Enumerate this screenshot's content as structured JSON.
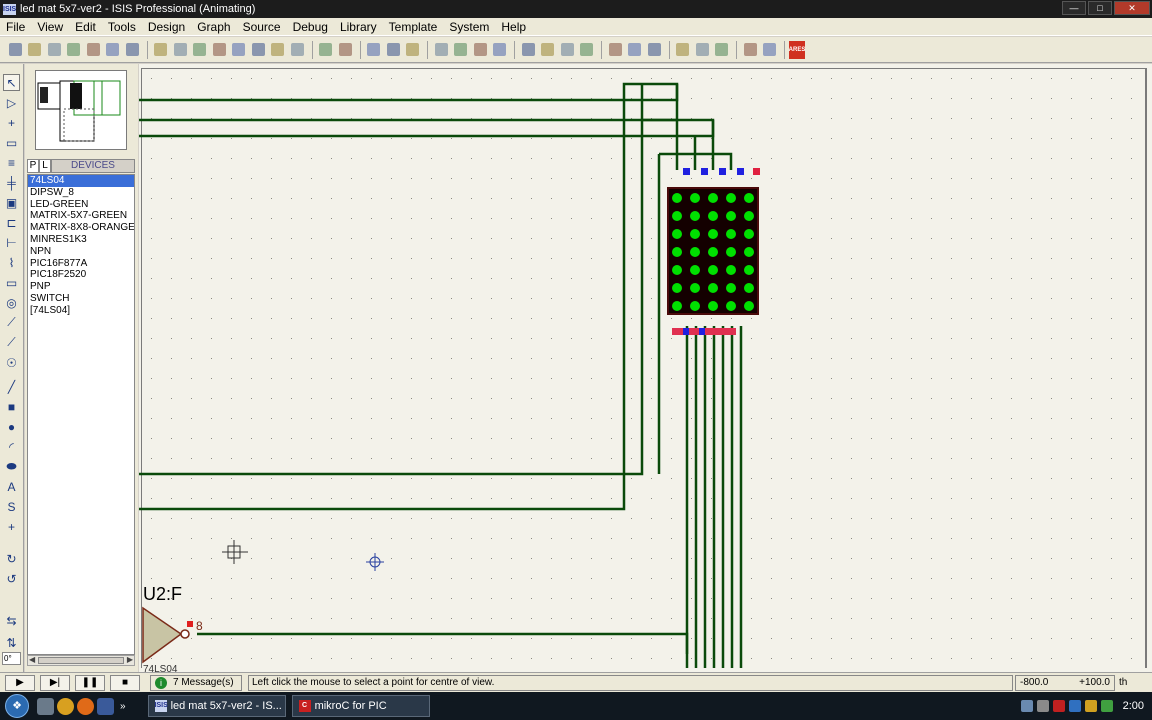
{
  "window": {
    "title": "led mat 5x7-ver2 - ISIS Professional (Animating)",
    "app_icon": "ISIS",
    "controls": [
      "minimize",
      "maximize",
      "close"
    ]
  },
  "menu": [
    "File",
    "View",
    "Edit",
    "Tools",
    "Design",
    "Graph",
    "Source",
    "Debug",
    "Library",
    "Template",
    "System",
    "Help"
  ],
  "toolbar": {
    "icons": [
      "new-icon",
      "open-icon",
      "save-icon",
      "import-icon",
      "export-icon",
      "print-icon",
      "print-area-icon",
      "|",
      "redraw-icon",
      "grid-icon",
      "origin-icon",
      "pan-icon",
      "zoom-in-icon",
      "zoom-out-icon",
      "zoom-all-icon",
      "zoom-area-icon",
      "|",
      "undo-icon",
      "redo-icon",
      "|",
      "cut-icon",
      "copy-icon",
      "paste-icon",
      "|",
      "block-copy-icon",
      "block-move-icon",
      "block-rotate-icon",
      "block-delete-icon",
      "|",
      "pick-device-icon",
      "make-device-icon",
      "packaging-icon",
      "decompose-icon",
      "|",
      "wire-autorouter-icon",
      "search-tag-icon",
      "property-assign-icon",
      "|",
      "new-sheet-icon",
      "remove-sheet-icon",
      "goto-sheet-icon",
      "|",
      "bom-icon",
      "erc-icon",
      "|",
      "ares-icon"
    ],
    "ares_label": "ARES"
  },
  "mode_tools": [
    "selection-mode-icon",
    "component-mode-icon",
    "junction-icon",
    "wire-label-icon",
    "text-script-icon",
    "bus-icon",
    "subcircuit-icon",
    "terminal-icon",
    "device-pin-icon",
    "graph-icon",
    "tape-recorder-icon",
    "generator-icon",
    "voltage-probe-icon",
    "current-probe-icon",
    "virtual-instruments-icon",
    "line-icon",
    "box-icon",
    "circle-icon",
    "arc-icon",
    "path-icon",
    "text-icon",
    "symbol-icon",
    "marker-icon",
    "rotate-cw-icon",
    "rotate-ccw-icon",
    "rotation-angle",
    "flip-horizontal-icon",
    "flip-vertical-icon"
  ],
  "rotation_value": "0°",
  "selector": {
    "tab_p": "P",
    "tab_l": "L",
    "label": "DEVICES",
    "devices": [
      "74LS04",
      "DIPSW_8",
      "LED-GREEN",
      "MATRIX-5X7-GREEN",
      "MATRIX-8X8-ORANGE",
      "MINRES1K3",
      "NPN",
      "PIC16F877A",
      "PIC18F2520",
      "PNP",
      "SWITCH",
      "[74LS04]"
    ],
    "selected_index": 0
  },
  "schematic": {
    "component_label": "U2:F",
    "pin_number": "8",
    "part_label_partial": "74LS04",
    "matrix_rows": 7,
    "matrix_cols": 5,
    "wire_color": "#0a4a0a",
    "led_on_color": "#00e000"
  },
  "simulation": {
    "buttons": [
      "play-icon",
      "step-icon",
      "pause-icon",
      "stop-icon"
    ],
    "messages": "7 Message(s)",
    "hint": "Left click the mouse to select a point for centre of view.",
    "coord_x": "-800.0",
    "coord_y": "+100.0",
    "unit": "th"
  },
  "taskbar": {
    "quick_launch": [
      "show-desktop-icon",
      "chrome-icon",
      "firefox-icon",
      "media-icon"
    ],
    "tasks": [
      {
        "icon": "ISIS",
        "label": "led mat 5x7-ver2 - IS..."
      },
      {
        "icon": "C",
        "label": "mikroC for PIC"
      }
    ],
    "tray_icons": [
      "network-icon",
      "volume-icon",
      "security-icon",
      "language-icon",
      "update-icon",
      "battery-icon"
    ],
    "clock": "2:00"
  }
}
